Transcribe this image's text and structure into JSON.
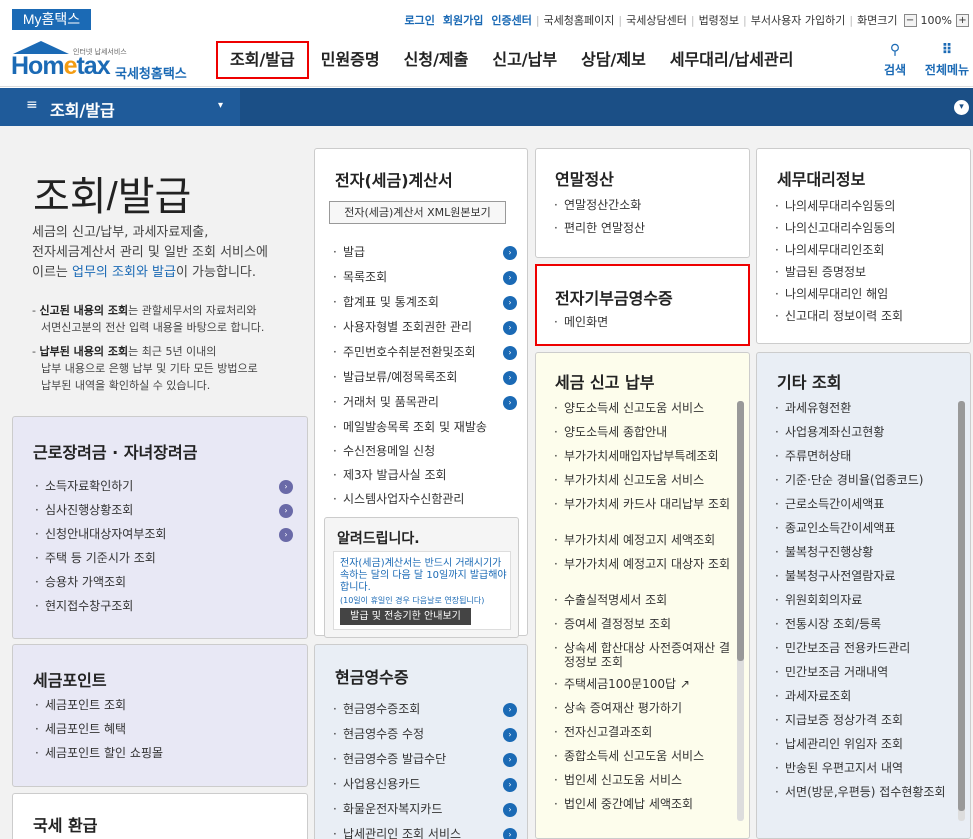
{
  "topbar": {
    "my_label": "My홈택스",
    "utils": [
      {
        "label": "로그인",
        "bold": true
      },
      {
        "label": "회원가입",
        "bold": true
      },
      {
        "label": "인증센터",
        "bold": true
      },
      {
        "label": "국세청홈페이지",
        "bold": false
      },
      {
        "label": "국세상담센터",
        "bold": false
      },
      {
        "label": "법령정보",
        "bold": false
      },
      {
        "label": "부서사용자 가입하기",
        "bold": false
      },
      {
        "label": "화면크기",
        "bold": false
      }
    ],
    "zoom": "100%",
    "zoom_minus": "−",
    "zoom_plus": "+"
  },
  "header": {
    "logo_small": "인터넷 납세서비스",
    "logo_main": "Hometax",
    "logo_ko": "국세청홈택스",
    "nav": [
      "조회/발급",
      "민원증명",
      "신청/제출",
      "신고/납부",
      "상담/제보",
      "세무대리/납세관리"
    ],
    "active_nav": "조회/발급",
    "search_label": "검색",
    "allmenu_label": "전체메뉴"
  },
  "titlebar": {
    "title": "조회/발급"
  },
  "intro": {
    "heading": "조회/발급",
    "desc_1": "세금의 신고/납부, 과세자료제출,",
    "desc_2": "전자세금계산서 관리 및 일반 조회 서비스에",
    "desc_3_pre": "이르는 ",
    "desc_3_hl": "업무의 조회와 발급",
    "desc_3_post": "이 가능합니다.",
    "note1_bold": "신고된 내용의 조회",
    "note1_rest": "는 관할세무서의 자료처리와",
    "note1_line2": "서면신고분의 전산 입력 내용을 바탕으로 합니다.",
    "note2_bold": "납부된 내용의 조회",
    "note2_rest": "는 최근 5년 이내의",
    "note2_line2": "납부 내용으로 은행 납부 및 기타 모든 방법으로",
    "note2_line3": "납부된 내역을 확인하실 수 있습니다."
  },
  "cards": {
    "einvoice": {
      "title": "전자(세금)계산서",
      "xml_button": "전자(세금)계산서 XML원본보기",
      "items": [
        "발급",
        "목록조회",
        "합계표 및 통계조회",
        "사용자형별 조회권한 관리",
        "주민번호수취분전환및조회",
        "발급보류/예정목록조회",
        "거래처 및 품목관리",
        "메일발송목록 조회 및 재발송",
        "수신전용메일 신청",
        "제3자 발급사실 조회",
        "시스템사업자수신함관리"
      ],
      "alert_title": "알려드립니다.",
      "alert_text_1": "전자(세금)계산서는 반드시 거래시기가 속하는 달의 다음 달 10일까지 발급해야 합니다.",
      "alert_text_2": "(10일이 휴일인 경우 다음날로 연장됩니다)",
      "alert_button": "발급 및 전송기한 안내보기"
    },
    "yearend": {
      "title": "연말정산",
      "items": [
        "연말정산간소화",
        "편리한 연말정산"
      ]
    },
    "donation": {
      "title": "전자기부금영수증",
      "items": [
        "메인화면"
      ]
    },
    "taxagent": {
      "title": "세무대리정보",
      "items": [
        "나의세무대리수임동의",
        "나의신고대리수임동의",
        "나의세무대리인조회",
        "발급된 증명정보",
        "나의세무대리인 해임",
        "신고대리 정보이력 조회"
      ]
    },
    "taxreturn": {
      "title": "세금 신고 납부",
      "items": [
        "양도소득세 신고도움 서비스",
        "양도소득세 종합안내",
        "부가가치세매입자납부특례조회",
        "부가가치세 신고도움 서비스",
        "부가가치세 카드사 대리납부 조회",
        "부가가치세 예정고지 세액조회",
        "부가가치세 예정고지 대상자 조회",
        "수출실적명세서 조회",
        "증여세 결정정보 조회",
        "상속세 합산대상 사전증여재산 결정정보 조회",
        "주택세금100문100답",
        "상속 증여재산 평가하기",
        "전자신고결과조회",
        "종합소득세 신고도움 서비스",
        "법인세 신고도움 서비스",
        "법인세 중간예납 세액조회"
      ]
    },
    "other": {
      "title": "기타 조회",
      "items": [
        "과세유형전환",
        "사업용계좌신고현황",
        "주류면허상태",
        "기준·단순 경비율(업종코드)",
        "근로소득간이세액표",
        "종교인소득간이세액표",
        "불복청구진행상황",
        "불복청구사전열람자료",
        "위원회회의자료",
        "전통시장 조회/등록",
        "민간보조금 전용카드관리",
        "민간보조금 거래내역",
        "과세자료조회",
        "지급보증 정상가격 조회",
        "납세관리인 위임자 조회",
        "반송된 우편고지서 내역",
        "서면(방문,우편등) 접수현황조회"
      ]
    },
    "earned": {
      "title": "근로장려금 · 자녀장려금",
      "items": [
        "소득자료확인하기",
        "심사진행상황조회",
        "신청안내대상자여부조회",
        "주택 등 기준시가 조회",
        "승용차 가액조회",
        "현지접수창구조회"
      ]
    },
    "points": {
      "title": "세금포인트",
      "items": [
        "세금포인트 조회",
        "세금포인트 혜택",
        "세금포인트 할인 쇼핑몰"
      ]
    },
    "cash": {
      "title": "현금영수증",
      "items": [
        "현금영수증조회",
        "현금영수증 수정",
        "현금영수증 발급수단",
        "사업용신용카드",
        "화물운전자복지카드",
        "납세관리인 조회 서비스"
      ]
    },
    "refund": {
      "title": "국세 환급"
    }
  },
  "icons": {
    "go": "›",
    "search": "⚲",
    "allmenu": "⠿",
    "hamburger": "≡",
    "dropdown": "▾",
    "external": "↗"
  }
}
